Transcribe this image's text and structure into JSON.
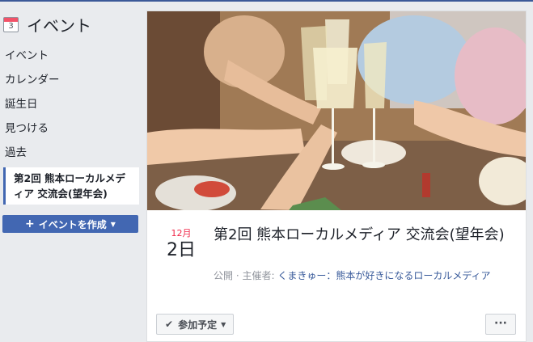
{
  "sidebar": {
    "icon_date": "3",
    "title": "イベント",
    "items": [
      {
        "label": "イベント"
      },
      {
        "label": "カレンダー"
      },
      {
        "label": "誕生日"
      },
      {
        "label": "見つける"
      },
      {
        "label": "過去"
      }
    ],
    "selected_event": "第2回 熊本ローカルメディア 交流会(望年会)",
    "create_button": "イベントを作成",
    "create_icon": "plus-icon"
  },
  "event": {
    "photo": "toast-glasses-photo",
    "date_month": "12月",
    "date_day": "2日",
    "title": "第2回 熊本ローカルメディア 交流会(望年会)",
    "visibility": "公開",
    "host_prefix": "主催者:",
    "host_name": "くまきゅー：熊本が好きになるローカルメディア",
    "going_label": "参加予定",
    "more_label": "···"
  },
  "colors": {
    "accent": "#4267b2",
    "date_month": "#f02849",
    "background": "#e9ebee"
  }
}
